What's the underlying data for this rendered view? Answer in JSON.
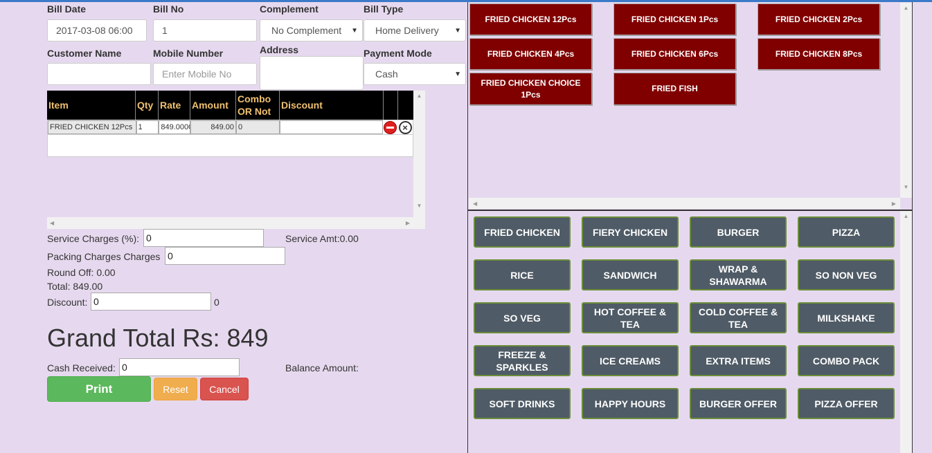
{
  "form": {
    "bill_date_label": "Bill Date",
    "bill_date_value": "2017-03-08 06:00",
    "bill_no_label": "Bill No",
    "bill_no_value": "1",
    "complement_label": "Complement",
    "complement_value": "No Complement",
    "bill_type_label": "Bill Type",
    "bill_type_value": "Home Delivery",
    "customer_name_label": "Customer Name",
    "customer_name_value": "",
    "mobile_label": "Mobile Number",
    "mobile_placeholder": "Enter Mobile No",
    "address_label": "Address",
    "payment_mode_label": "Payment Mode",
    "payment_mode_value": "Cash"
  },
  "grid": {
    "columns": [
      "Item",
      "Qty",
      "Rate",
      "Amount",
      "Combo OR Not",
      "Discount"
    ],
    "rows": [
      {
        "item": "FRIED CHICKEN 12Pcs",
        "qty": "1",
        "rate": "849.0000",
        "amount": "849.00",
        "combo": "0",
        "discount": ""
      }
    ]
  },
  "summary": {
    "service_charges_label": "Service Charges (%):",
    "service_charges_value": "0",
    "service_amt": "Service Amt:0.00",
    "packing_label": "Packing Charges Charges",
    "packing_value": "0",
    "round_off": "Round Off: 0.00",
    "total": "Total: 849.00",
    "discount_label": "Discount:",
    "discount_value": "0",
    "discount_result": "0",
    "grand_total": "Grand Total Rs: 849",
    "cash_received_label": "Cash Received:",
    "cash_received_value": "0",
    "balance_label": "Balance Amount:"
  },
  "actions": {
    "print": "Print",
    "reset": "Reset",
    "cancel": "Cancel"
  },
  "items": [
    "FRIED CHICKEN 12Pcs",
    "FRIED CHICKEN 1Pcs",
    "FRIED CHICKEN 2Pcs",
    "FRIED CHICKEN 4Pcs",
    "FRIED CHICKEN 6Pcs",
    "FRIED CHICKEN 8Pcs",
    "FRIED CHICKEN CHOICE 1Pcs",
    "FRIED FISH"
  ],
  "categories": [
    "FRIED CHICKEN",
    "FIERY CHICKEN",
    "BURGER",
    "PIZZA",
    "RICE",
    "SANDWICH",
    "WRAP & SHAWARMA",
    "SO NON VEG",
    "SO VEG",
    "HOT COFFEE & TEA",
    "COLD COFFEE & TEA",
    "MILKSHAKE",
    "FREEZE & SPARKLES",
    "ICE CREAMS",
    "EXTRA ITEMS",
    "COMBO PACK",
    "SOFT DRINKS",
    "HAPPY HOURS",
    "BURGER OFFER",
    "PIZZA OFFER"
  ],
  "colors": {
    "item_button": "#800000",
    "category_button": "#4f5b66",
    "print": "#5cb85c",
    "reset": "#f0ad4e",
    "cancel": "#d9534f"
  }
}
